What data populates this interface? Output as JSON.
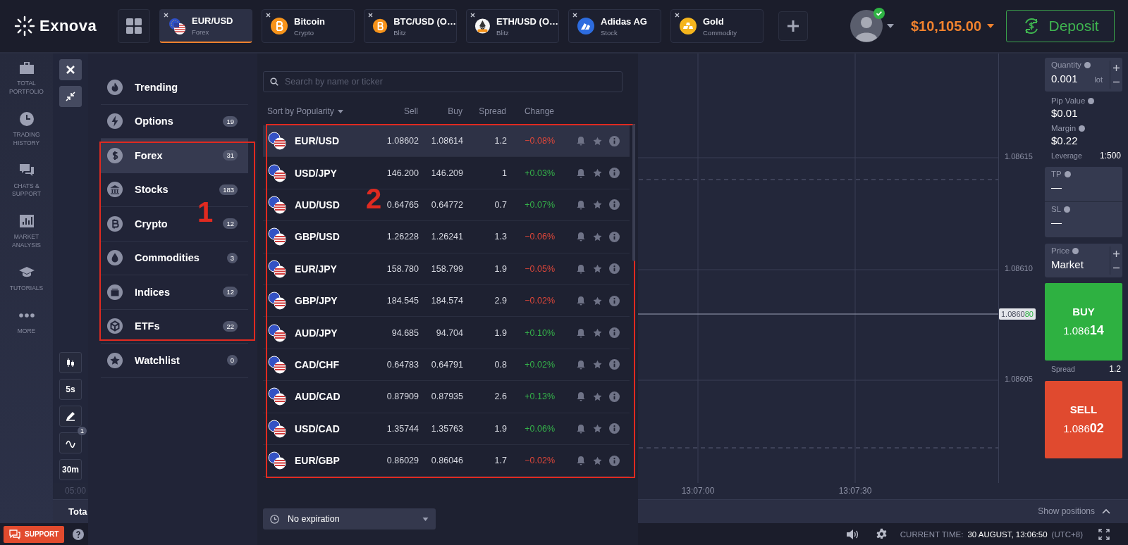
{
  "logo": {
    "name": "Exnova"
  },
  "tabs": [
    {
      "title": "EUR/USD",
      "subtitle": "Forex",
      "kind": "flags",
      "selected": true
    },
    {
      "title": "Bitcoin",
      "subtitle": "Crypto",
      "kind": "bitcoin",
      "selected": false
    },
    {
      "title": "BTC/USD (O…",
      "subtitle": "Blitz",
      "kind": "bitcoin",
      "selected": false
    },
    {
      "title": "ETH/USD (O…",
      "subtitle": "Blitz",
      "kind": "ethereum",
      "selected": false
    },
    {
      "title": "Adidas AG",
      "subtitle": "Stock",
      "kind": "stock",
      "selected": false
    },
    {
      "title": "Gold",
      "subtitle": "Commodity",
      "kind": "gold",
      "selected": false
    }
  ],
  "account": {
    "balance": "$10,105.00",
    "verified": true,
    "deposit": "Deposit"
  },
  "left_nav": [
    {
      "label": "TOTAL PORTFOLIO",
      "kind": "portfolio"
    },
    {
      "label": "TRADING HISTORY",
      "kind": "history"
    },
    {
      "label": "CHATS & SUPPORT",
      "kind": "chats"
    },
    {
      "label": "MARKET ANALYSIS",
      "kind": "analysis"
    },
    {
      "label": "TUTORIALS",
      "kind": "tutorials"
    },
    {
      "label": "MORE",
      "kind": "more"
    }
  ],
  "chart_tools": [
    {
      "kind": "candles"
    },
    {
      "kind": "text",
      "label": "5s"
    },
    {
      "kind": "pencil"
    },
    {
      "kind": "indicators",
      "badge": "1"
    },
    {
      "kind": "text",
      "label": "30m"
    }
  ],
  "categories": [
    {
      "label": "Trending",
      "kind": "trending",
      "selected": false
    },
    {
      "label": "Options",
      "kind": "options",
      "count": "19",
      "selected": false
    },
    {
      "label": "Forex",
      "kind": "forex",
      "count": "31",
      "selected": true
    },
    {
      "label": "Stocks",
      "kind": "stocks",
      "count": "183",
      "selected": false
    },
    {
      "label": "Crypto",
      "kind": "crypto",
      "count": "12",
      "selected": false
    },
    {
      "label": "Commodities",
      "kind": "commodities",
      "count": "3",
      "selected": false
    },
    {
      "label": "Indices",
      "kind": "indices",
      "count": "12",
      "selected": false
    },
    {
      "label": "ETFs",
      "kind": "etfs",
      "count": "22",
      "selected": false
    },
    {
      "label": "Watchlist",
      "kind": "watchlist",
      "count": "0",
      "selected": false
    }
  ],
  "search": {
    "placeholder": "Search by name or ticker"
  },
  "sort": "Sort by Popularity",
  "columns": [
    "Sell",
    "Buy",
    "Spread",
    "Change"
  ],
  "assets": [
    {
      "pair": "EUR/USD",
      "sell": "1.08602",
      "buy": "1.08614",
      "spread": "1.2",
      "change": "−0.08%",
      "color": "#e0473a",
      "selected": true
    },
    {
      "pair": "USD/JPY",
      "sell": "146.200",
      "buy": "146.209",
      "spread": "1",
      "change": "+0.03%",
      "color": "#35b34a",
      "selected": false
    },
    {
      "pair": "AUD/USD",
      "sell": "0.64765",
      "buy": "0.64772",
      "spread": "0.7",
      "change": "+0.07%",
      "color": "#35b34a",
      "selected": false
    },
    {
      "pair": "GBP/USD",
      "sell": "1.26228",
      "buy": "1.26241",
      "spread": "1.3",
      "change": "−0.06%",
      "color": "#e0473a",
      "selected": false
    },
    {
      "pair": "EUR/JPY",
      "sell": "158.780",
      "buy": "158.799",
      "spread": "1.9",
      "change": "−0.05%",
      "color": "#e0473a",
      "selected": false
    },
    {
      "pair": "GBP/JPY",
      "sell": "184.545",
      "buy": "184.574",
      "spread": "2.9",
      "change": "−0.02%",
      "color": "#e0473a",
      "selected": false
    },
    {
      "pair": "AUD/JPY",
      "sell": "94.685",
      "buy": "94.704",
      "spread": "1.9",
      "change": "+0.10%",
      "color": "#35b34a",
      "selected": false
    },
    {
      "pair": "CAD/CHF",
      "sell": "0.64783",
      "buy": "0.64791",
      "spread": "0.8",
      "change": "+0.02%",
      "color": "#35b34a",
      "selected": false
    },
    {
      "pair": "AUD/CAD",
      "sell": "0.87909",
      "buy": "0.87935",
      "spread": "2.6",
      "change": "+0.13%",
      "color": "#35b34a",
      "selected": false
    },
    {
      "pair": "USD/CAD",
      "sell": "1.35744",
      "buy": "1.35763",
      "spread": "1.9",
      "change": "+0.06%",
      "color": "#35b34a",
      "selected": false
    },
    {
      "pair": "EUR/GBP",
      "sell": "0.86029",
      "buy": "0.86046",
      "spread": "1.7",
      "change": "−0.02%",
      "color": "#e0473a",
      "selected": false
    }
  ],
  "expiration": "No expiration",
  "annotations": [
    {
      "label": "1"
    },
    {
      "label": "2"
    }
  ],
  "chart": {
    "price_labels": [
      "1.08615",
      "1.08610",
      "1.08605"
    ],
    "current_price": {
      "main": "1.0860",
      "tail": "80"
    },
    "time_labels": [
      "05:00",
      "13:07:00",
      "13:07:30"
    ]
  },
  "positions_bar": {
    "label": "Tota",
    "action": "Show positions"
  },
  "trade_panel": {
    "quantity_label": "Quantity",
    "quantity": "0.001",
    "unit": "lot",
    "pip_label": "Pip Value",
    "pip_value": "$0.01",
    "margin_label": "Margin",
    "margin": "$0.22",
    "leverage_label": "Leverage",
    "leverage": "1:500",
    "tp_label": "TP",
    "tp": "—",
    "sl_label": "SL",
    "sl": "—",
    "price_label": "Price",
    "price": "Market",
    "buy_label": "BUY",
    "buy_price": "1.086**14**",
    "spread_label": "Spread",
    "spread": "1.2",
    "sell_label": "SELL",
    "sell_price": "1.086**02**"
  },
  "status_bar": {
    "support": "SUPPORT",
    "time_label": "CURRENT TIME:",
    "time": "30 AUGUST, 13:06:50",
    "timezone": "(UTC+8)"
  }
}
